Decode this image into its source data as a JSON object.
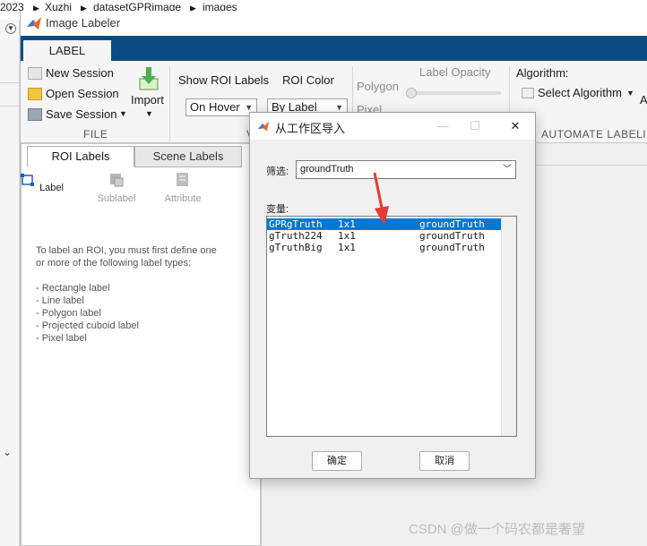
{
  "path_strip": {
    "crumbs": [
      "2023",
      "Xuzhi",
      "datasetGPRimage",
      "images"
    ]
  },
  "app": {
    "title": "Image Labeler",
    "tab": "LABEL"
  },
  "ribbon": {
    "file": {
      "new_session": "New Session",
      "open_session": "Open Session",
      "save_session": "Save Session",
      "import": "Import",
      "group_title": "FILE"
    },
    "view": {
      "show_roi_labels": "Show ROI Labels",
      "show_roi_value": "On Hover",
      "roi_color": "ROI Color",
      "roi_color_value": "By Label",
      "group_title_partial": "V"
    },
    "opacity": {
      "title": "Label Opacity",
      "polygon": "Polygon",
      "pixel": "Pixel",
      "polygon_level": 0.0
    },
    "algorithm": {
      "label": "Algorithm:",
      "select": "Select Algorithm",
      "extra_partial": "A",
      "group_title": "AUTOMATE LABELI"
    }
  },
  "left_panel": {
    "tabs": [
      "ROI Labels",
      "Scene Labels"
    ],
    "tools": {
      "label": "Label",
      "sublabel": "Sublabel",
      "attribute": "Attribute"
    },
    "help_lines": [
      "To label an ROI, you must first define one",
      "or more of the following label types:",
      "",
      "- Rectangle label",
      "- Line label",
      "- Polygon label",
      "- Projected cuboid label",
      "- Pixel label"
    ]
  },
  "dialog": {
    "title": "从工作区导入",
    "filter_label": "筛选:",
    "filter_value": "groundTruth",
    "variables_label": "变量:",
    "rows": [
      {
        "name": "GPRgTruth",
        "size": "1x1",
        "type": "groundTruth",
        "selected": true
      },
      {
        "name": "gTruth224",
        "size": "1x1",
        "type": "groundTruth",
        "selected": false
      },
      {
        "name": "gTruthBig",
        "size": "1x1",
        "type": "groundTruth",
        "selected": false
      }
    ],
    "ok": "确定",
    "cancel": "取消"
  },
  "watermark": "CSDN @做一个码农都是奢望",
  "colors": {
    "ribbon_blue": "#0a4b83",
    "selection_blue": "#0078d7",
    "annotation_red": "#e53935"
  }
}
